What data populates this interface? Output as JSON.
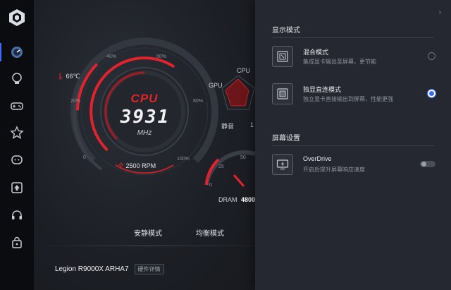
{
  "sidebar": {
    "items": [
      {
        "icon": "dashboard-icon",
        "active": true
      },
      {
        "icon": "bulb-icon",
        "active": false
      },
      {
        "icon": "gamepad-icon",
        "active": false
      },
      {
        "icon": "star-icon",
        "active": false
      },
      {
        "icon": "chat-icon",
        "active": false
      },
      {
        "icon": "upload-icon",
        "active": false
      },
      {
        "icon": "headset-icon",
        "active": false
      },
      {
        "icon": "bag-icon",
        "active": false
      }
    ]
  },
  "gauge": {
    "label": "CPU",
    "value": "3931",
    "unit": "MHz",
    "fan_speed": "2500 RPM",
    "temperature": "66℃",
    "ticks": [
      "0",
      "20%",
      "40%",
      "60%",
      "80%",
      "100%"
    ],
    "load_fraction": 0.62,
    "temp_fraction": 0.55
  },
  "radar": {
    "labels": [
      "CPU",
      "GPU",
      "静音",
      "1"
    ]
  },
  "dram": {
    "label": "DRAM",
    "value": "4800",
    "ticks": [
      "0",
      "25",
      "50"
    ]
  },
  "modes": {
    "quiet": "安静模式",
    "balanced": "均衡模式"
  },
  "footer": {
    "model": "Legion R9000X ARHA7",
    "details_label": "硬件详情"
  },
  "panel": {
    "display_mode_title": "显示模式",
    "options": [
      {
        "title": "混合模式",
        "desc": "集成显卡输出至屏幕，更节能",
        "selected": false
      },
      {
        "title": "独显直连模式",
        "desc": "独立显卡直接输出到屏幕，性能更强",
        "selected": true
      }
    ],
    "screen_settings_title": "屏幕设置",
    "overdrive": {
      "title": "OverDrive",
      "desc": "开启后提升屏幕响应速度",
      "enabled": false
    }
  },
  "colors": {
    "accent_red": "#e0232c",
    "accent_blue": "#3c6bff"
  }
}
